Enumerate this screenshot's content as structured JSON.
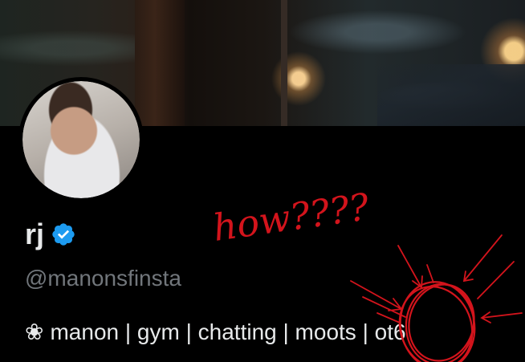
{
  "profile": {
    "display_name": "rj",
    "handle": "@manonsfinsta",
    "bio_symbol": "❀",
    "bio": "manon | gym | chatting | moots | ot6",
    "verified": true,
    "verified_color": "#1d9bf0"
  },
  "annotation": {
    "text": "how????",
    "color": "#d3141c"
  },
  "icons": {
    "verified": "verified-badge-icon",
    "bio_symbol": "flower-icon"
  }
}
